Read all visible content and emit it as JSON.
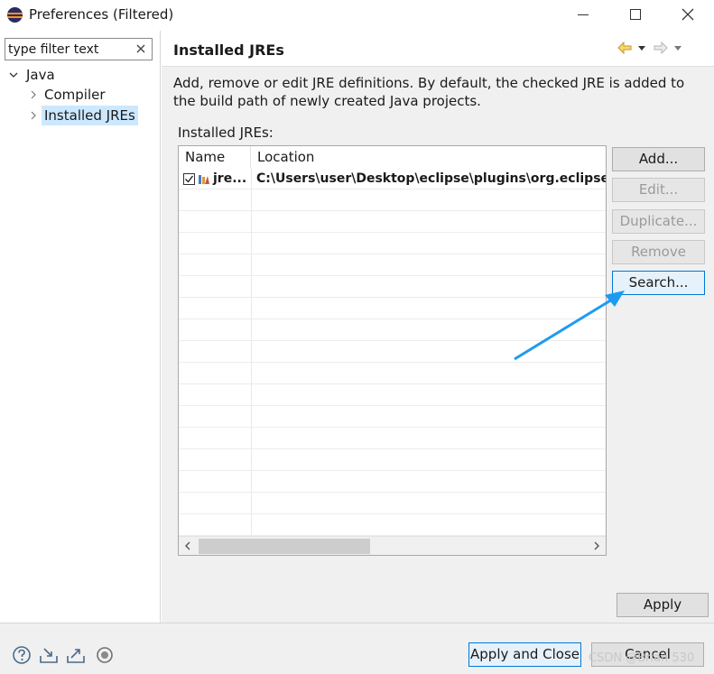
{
  "window": {
    "title": "Preferences (Filtered)"
  },
  "filter": {
    "placeholder": "type filter text"
  },
  "tree": {
    "items": [
      {
        "label": "Java"
      },
      {
        "label": "Compiler"
      },
      {
        "label": "Installed JREs"
      }
    ]
  },
  "page": {
    "title": "Installed JREs",
    "description": "Add, remove or edit JRE definitions. By default, the checked JRE is added to the build path of newly created Java projects.",
    "section_label": "Installed JREs:"
  },
  "table": {
    "columns": [
      "Name",
      "Location"
    ],
    "rows": [
      {
        "name": "jre...",
        "location": "C:\\Users\\user\\Desktop\\eclipse\\plugins\\org.eclipse.ju",
        "checked": true
      }
    ]
  },
  "buttons": {
    "add": "Add...",
    "edit": "Edit...",
    "duplicate": "Duplicate...",
    "remove": "Remove",
    "search": "Search...",
    "apply": "Apply",
    "apply_close": "Apply and Close",
    "cancel": "Cancel"
  },
  "watermark": "CSDN @Brian 530",
  "colors": {
    "selection": "#cce8ff",
    "annotation_arrow": "#1e9bf0",
    "focus_border": "#0078d7"
  }
}
